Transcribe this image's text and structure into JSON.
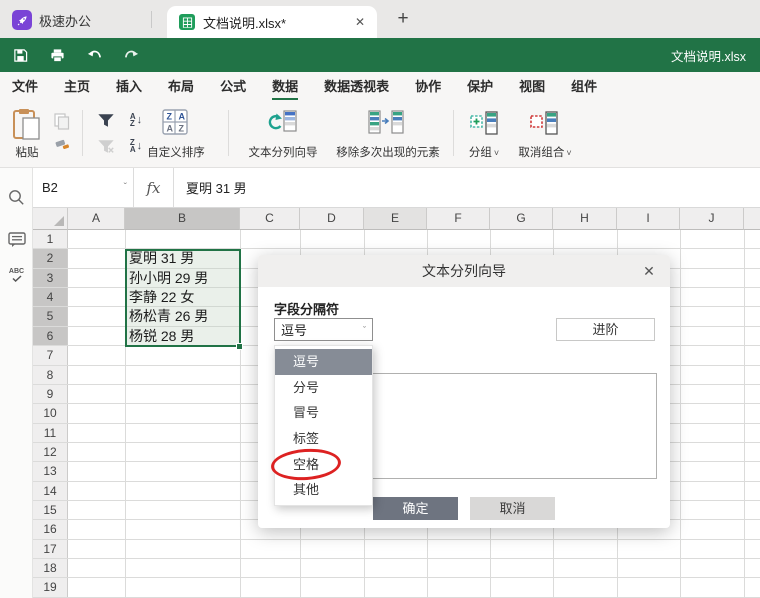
{
  "icons": {
    "chevron_down": "˅",
    "close": "✕",
    "plus": "+",
    "fx": "fx",
    "name_box_chevron": "ˇ",
    "spellcheck_abc": "ABC",
    "sort_a": "A",
    "sort_z": "Z",
    "sort_arrow": "↓"
  },
  "tab_bar": {
    "app_name": "极速办公",
    "tab_title": "文档说明.xlsx*"
  },
  "title_bar": {
    "document_title": "文档说明.xlsx"
  },
  "menu": {
    "items": [
      "文件",
      "主页",
      "插入",
      "布局",
      "公式",
      "数据",
      "数据透视表",
      "协作",
      "保护",
      "视图",
      "组件"
    ],
    "active": "数据"
  },
  "ribbon": {
    "paste": "粘贴",
    "custom_sort": "自定义排序",
    "text_to_columns": "文本分列向导",
    "remove_duplicates": "移除多次出现的元素",
    "group": "分组",
    "ungroup": "取消组合"
  },
  "formula_bar": {
    "name_box": "B2",
    "content": "夏明 31 男"
  },
  "grid": {
    "columns": [
      "A",
      "B",
      "C",
      "D",
      "E",
      "F",
      "G",
      "H",
      "I",
      "J"
    ],
    "selected_column": "B",
    "selected_range": "B2:B6",
    "row_numbers": [
      "1",
      "2",
      "3",
      "4",
      "5",
      "6",
      "7",
      "8",
      "9",
      "10",
      "11",
      "12",
      "13",
      "14",
      "15",
      "16",
      "17",
      "18",
      "19"
    ],
    "cells": [
      {
        "ref": "B2",
        "value": "夏明 31 男"
      },
      {
        "ref": "B3",
        "value": "孙小明 29 男"
      },
      {
        "ref": "B4",
        "value": "李静 22 女"
      },
      {
        "ref": "B5",
        "value": "杨松青 26 男"
      },
      {
        "ref": "B6",
        "value": "杨锐 28 男"
      }
    ]
  },
  "dialog": {
    "title": "文本分列向导",
    "delimiter_label": "字段分隔符",
    "delimiter_value": "逗号",
    "advanced": "进阶",
    "ok": "确定",
    "cancel": "取消"
  },
  "dropdown": {
    "options": [
      "逗号",
      "分号",
      "冒号",
      "标签",
      "空格",
      "其他"
    ],
    "highlighted": "逗号",
    "annotated": "空格"
  },
  "colors": {
    "brand_green": "#217346",
    "annotation_red": "#dd2222",
    "dropdown_highlight": "#868c96"
  }
}
